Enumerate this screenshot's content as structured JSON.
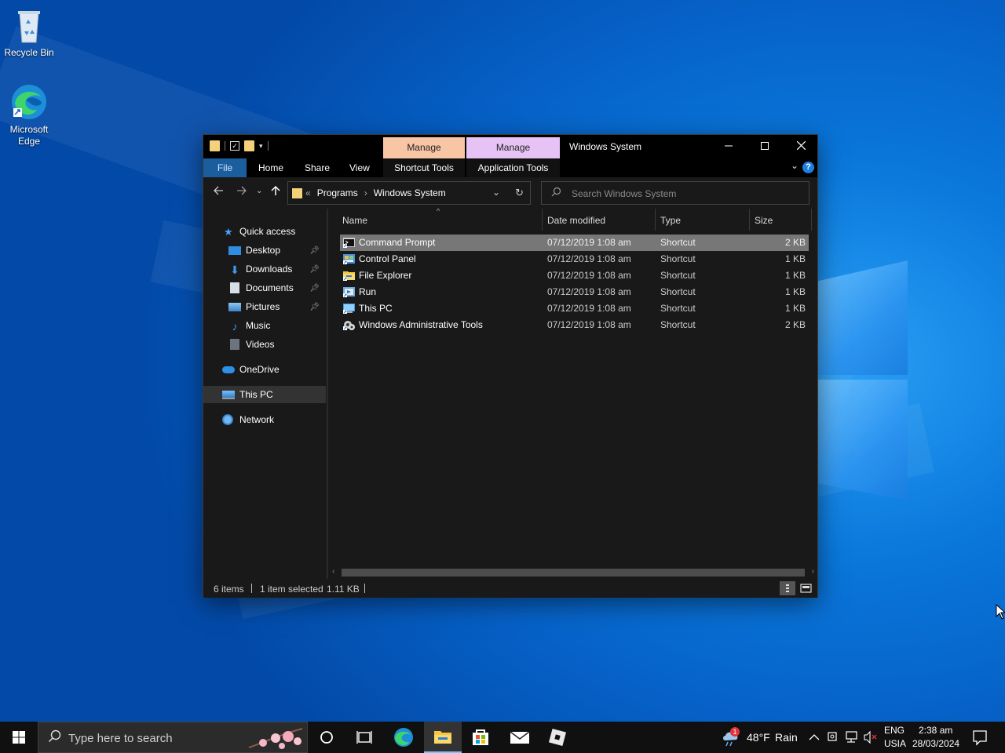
{
  "desktop": {
    "icons": [
      {
        "label": "Recycle Bin"
      },
      {
        "label": "Microsoft Edge"
      }
    ]
  },
  "window": {
    "title": "Windows System",
    "context_tabs": [
      {
        "label": "Manage",
        "color": "#f8c5a5"
      },
      {
        "label": "Manage",
        "color": "#e7c3f5"
      }
    ],
    "ribbon_tabs": [
      "File",
      "Home",
      "Share",
      "View",
      "Shortcut Tools",
      "Application Tools"
    ],
    "address": {
      "prefix": "«",
      "crumbs": [
        "Programs",
        "Windows System"
      ]
    },
    "search_placeholder": "Search Windows System",
    "nav_pane": [
      {
        "label": "Quick access",
        "icon": "star-icon"
      },
      {
        "label": "Desktop",
        "icon": "desktop-icon",
        "pinned": true
      },
      {
        "label": "Downloads",
        "icon": "download-icon",
        "pinned": true
      },
      {
        "label": "Documents",
        "icon": "document-icon",
        "pinned": true
      },
      {
        "label": "Pictures",
        "icon": "picture-icon",
        "pinned": true
      },
      {
        "label": "Music",
        "icon": "music-icon"
      },
      {
        "label": "Videos",
        "icon": "video-icon"
      },
      {
        "label": "OneDrive",
        "icon": "cloud-icon"
      },
      {
        "label": "This PC",
        "icon": "computer-icon",
        "selected": true
      },
      {
        "label": "Network",
        "icon": "network-icon"
      }
    ],
    "columns": [
      "Name",
      "Date modified",
      "Type",
      "Size"
    ],
    "files": [
      {
        "name": "Command Prompt",
        "date": "07/12/2019 1:08 am",
        "type": "Shortcut",
        "size": "2 KB",
        "selected": true,
        "icon": "cmd-icon"
      },
      {
        "name": "Control Panel",
        "date": "07/12/2019 1:08 am",
        "type": "Shortcut",
        "size": "1 KB",
        "icon": "control-panel-icon"
      },
      {
        "name": "File Explorer",
        "date": "07/12/2019 1:08 am",
        "type": "Shortcut",
        "size": "1 KB",
        "icon": "folder-icon"
      },
      {
        "name": "Run",
        "date": "07/12/2019 1:08 am",
        "type": "Shortcut",
        "size": "1 KB",
        "icon": "run-icon"
      },
      {
        "name": "This PC",
        "date": "07/12/2019 1:08 am",
        "type": "Shortcut",
        "size": "1 KB",
        "icon": "computer-icon"
      },
      {
        "name": "Windows Administrative Tools",
        "date": "07/12/2019 1:08 am",
        "type": "Shortcut",
        "size": "2 KB",
        "icon": "admin-tools-icon"
      }
    ],
    "status": {
      "items": "6 items",
      "selected": "1 item selected",
      "size": "1.11 KB"
    }
  },
  "taskbar": {
    "search_placeholder": "Type here to search",
    "weather": {
      "temp": "48°F",
      "desc": "Rain",
      "badge": "1"
    },
    "language": {
      "line1": "ENG",
      "line2": "USIA"
    },
    "clock": {
      "time": "2:38 am",
      "date": "28/03/2024"
    }
  }
}
